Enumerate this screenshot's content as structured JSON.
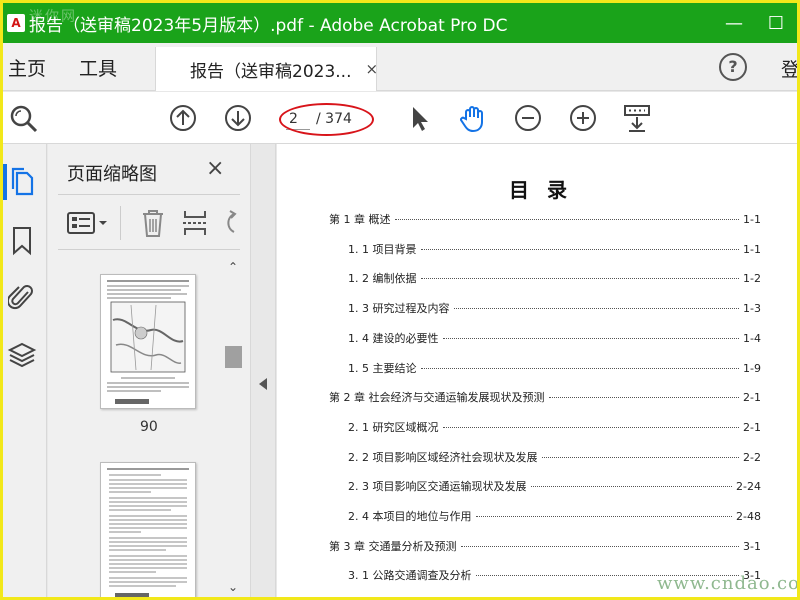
{
  "window": {
    "title": "报告（送审稿2023年5月版本）.pdf - Adobe Acrobat Pro DC",
    "app_icon_letter": "A",
    "watermark_top": "迷你网",
    "minimize": "—",
    "maximize": "☐"
  },
  "tabs": {
    "home": "主页",
    "tools": "工具",
    "document": "报告（送审稿2023...",
    "close": "×",
    "help": "?",
    "login": "登"
  },
  "toolbar": {
    "current_page": "2",
    "total_pages": "/ 374"
  },
  "sidebar": {
    "panel_title": "页面缩略图",
    "close": "×",
    "thumbnail_label": "90"
  },
  "document": {
    "toc_title": "目录",
    "entries": [
      {
        "text": "第 1 章  概述",
        "page": "1-1",
        "level": 1
      },
      {
        "text": "1. 1 项目背景",
        "page": "1-1",
        "level": 2
      },
      {
        "text": "1. 2 编制依据",
        "page": "1-2",
        "level": 2
      },
      {
        "text": "1. 3 研究过程及内容",
        "page": "1-3",
        "level": 2
      },
      {
        "text": "1. 4 建设的必要性",
        "page": "1-4",
        "level": 2
      },
      {
        "text": "1. 5 主要结论",
        "page": "1-9",
        "level": 2
      },
      {
        "text": "第 2 章  社会经济与交通运输发展现状及预测",
        "page": "2-1",
        "level": 1
      },
      {
        "text": "2. 1 研究区域概况",
        "page": "2-1",
        "level": 2
      },
      {
        "text": "2. 2 项目影响区域经济社会现状及发展",
        "page": "2-2",
        "level": 2
      },
      {
        "text": "2. 3 项目影响区交通运输现状及发展",
        "page": "2-24",
        "level": 2
      },
      {
        "text": "2. 4 本项目的地位与作用",
        "page": "2-48",
        "level": 2
      },
      {
        "text": "第 3 章  交通量分析及预测",
        "page": "3-1",
        "level": 1
      },
      {
        "text": "3. 1 公路交通调查及分析",
        "page": "3-1",
        "level": 2
      }
    ]
  },
  "watermark_bottom": "www.cndao.com"
}
